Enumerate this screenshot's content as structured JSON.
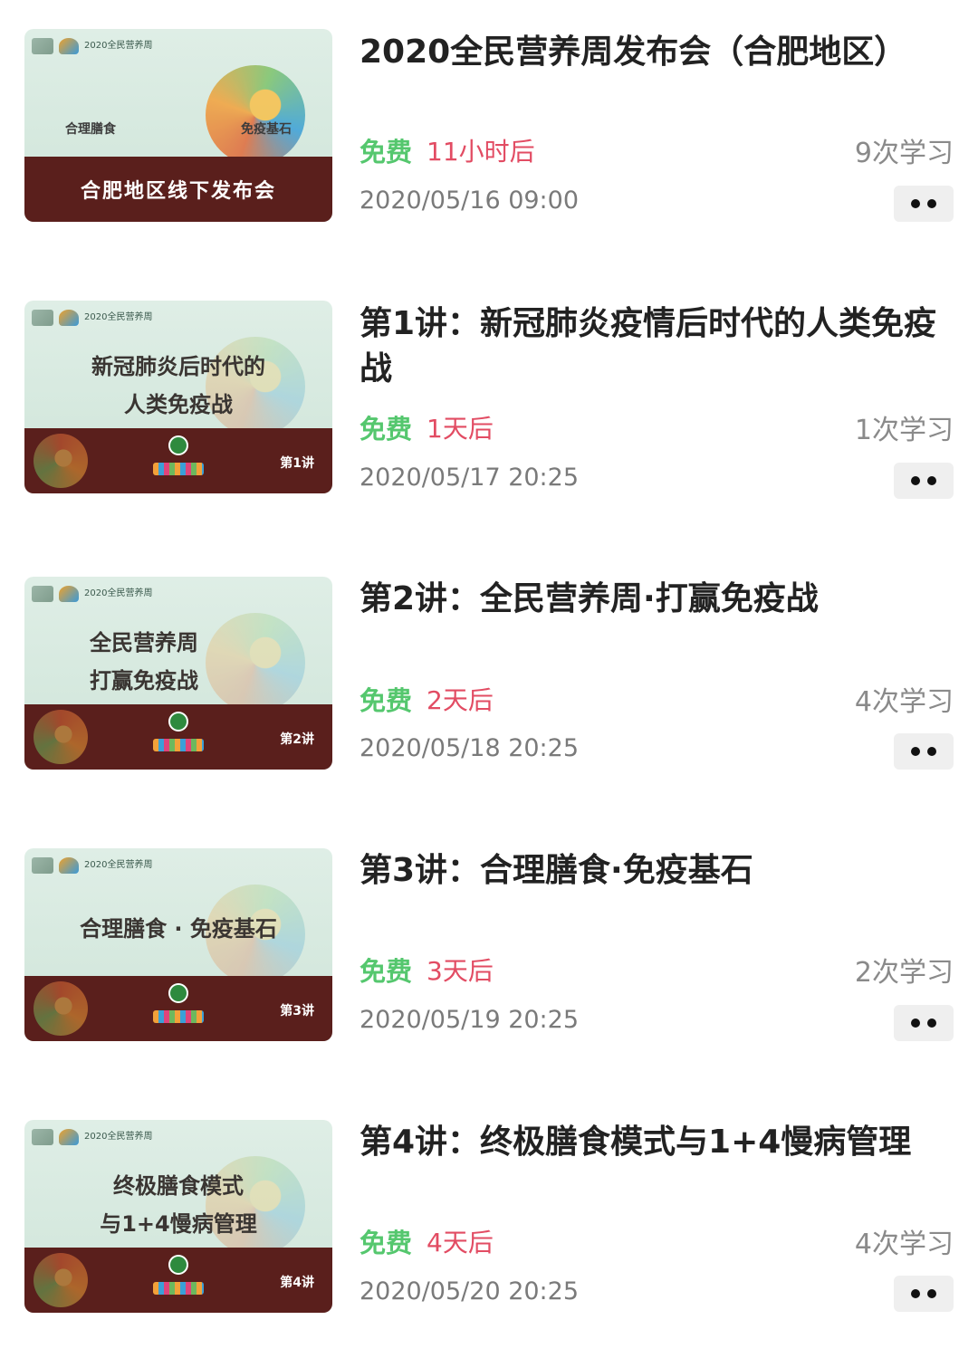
{
  "courses": [
    {
      "title": "2020全民营养周发布会（合肥地区）",
      "price_label": "免费",
      "time_label": "11小时后",
      "learn_count": "9次学习",
      "date": "2020/05/16 09:00",
      "thumb": {
        "header_text": "2020全民营养周",
        "left_text": "合理膳食",
        "right_text": "免疫基石",
        "band_text": "合肥地区线下发布会"
      }
    },
    {
      "title": "第1讲：新冠肺炎疫情后时代的人类免疫战",
      "price_label": "免费",
      "time_label": "1天后",
      "learn_count": "1次学习",
      "date": "2020/05/17 20:25",
      "thumb": {
        "header_text": "2020全民营养周",
        "title": "新冠肺炎后时代的\n人类免疫战",
        "episode": "第1讲"
      }
    },
    {
      "title": "第2讲：全民营养周·打赢免疫战",
      "price_label": "免费",
      "time_label": "2天后",
      "learn_count": "4次学习",
      "date": "2020/05/18 20:25",
      "thumb": {
        "header_text": "2020全民营养周",
        "title": "全民营养周\n打赢免疫战",
        "episode": "第2讲"
      }
    },
    {
      "title": "第3讲：合理膳食·免疫基石",
      "price_label": "免费",
      "time_label": "3天后",
      "learn_count": "2次学习",
      "date": "2020/05/19 20:25",
      "thumb": {
        "header_text": "2020全民营养周",
        "title": "合理膳食 · 免疫基石",
        "episode": "第3讲"
      }
    },
    {
      "title": "第4讲：终极膳食模式与1+4慢病管理",
      "price_label": "免费",
      "time_label": "4天后",
      "learn_count": "4次学习",
      "date": "2020/05/20 20:25",
      "thumb": {
        "header_text": "2020全民营养周",
        "title": "终极膳食模式\n与1+4慢病管理",
        "episode": "第4讲"
      }
    }
  ],
  "colors": {
    "free": "#55c76e",
    "time": "#e24c63",
    "muted": "#8a8a8a",
    "thumb_band": "#5a1f1c"
  },
  "icons": {
    "more": "more-dots-icon"
  }
}
